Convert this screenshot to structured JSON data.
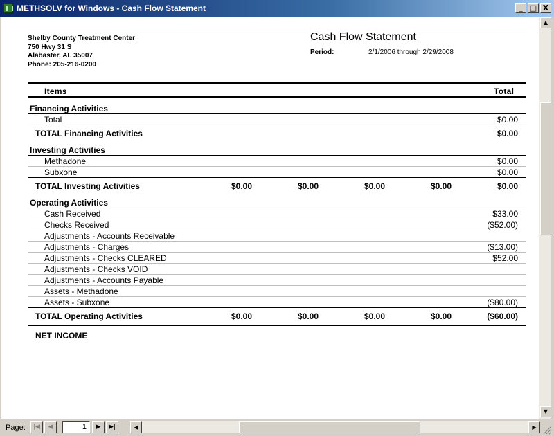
{
  "window": {
    "title": "METHSOLV for Windows - Cash Flow Statement",
    "controls": {
      "minimize": "_",
      "maximize": "□",
      "close": "X"
    }
  },
  "report": {
    "company": {
      "name": "Shelby County Treatment Center",
      "address1": "750 Hwy 31 S",
      "address2": "Alabaster, AL 35007",
      "phone": "Phone: 205-216-0200"
    },
    "title": "Cash Flow Statement",
    "period_label": "Period:",
    "period_value": "2/1/2006 through 2/29/2008",
    "columns": {
      "items": "Items",
      "total": "Total"
    },
    "financing": {
      "header": "Financing Activities",
      "rows": [
        {
          "label": "Total",
          "total": "$0.00"
        }
      ],
      "total_label": "TOTAL Financing Activities",
      "total_value": "$0.00"
    },
    "investing": {
      "header": "Investing Activities",
      "rows": [
        {
          "label": "Methadone",
          "total": "$0.00"
        },
        {
          "label": "Subxone",
          "total": "$0.00"
        }
      ],
      "total_label": "TOTAL Investing Activities",
      "total_cols": [
        "$0.00",
        "$0.00",
        "$0.00",
        "$0.00",
        "$0.00"
      ]
    },
    "operating": {
      "header": "Operating Activities",
      "rows": [
        {
          "label": "Cash Received",
          "total": "$33.00"
        },
        {
          "label": "Checks Received",
          "total": "($52.00)"
        },
        {
          "label": "Adjustments - Accounts Receivable",
          "total": ""
        },
        {
          "label": "Adjustments - Charges",
          "total": "($13.00)"
        },
        {
          "label": "Adjustments - Checks CLEARED",
          "total": "$52.00"
        },
        {
          "label": "Adjustments - Checks VOID",
          "total": ""
        },
        {
          "label": "Adjustments - Accounts Payable",
          "total": ""
        },
        {
          "label": "Assets - Methadone",
          "total": ""
        },
        {
          "label": "Assets - Subxone",
          "total": "($80.00)"
        }
      ],
      "total_label": "TOTAL Operating Activities",
      "total_cols": [
        "$0.00",
        "$0.00",
        "$0.00",
        "$0.00",
        "($60.00)"
      ]
    },
    "net_income_label": "NET INCOME"
  },
  "navigation": {
    "page_label": "Page:",
    "page_value": "1",
    "first_icon": "first-page-icon",
    "prev_icon": "prev-page-icon",
    "next_icon": "next-page-icon",
    "last_icon": "last-page-icon"
  }
}
